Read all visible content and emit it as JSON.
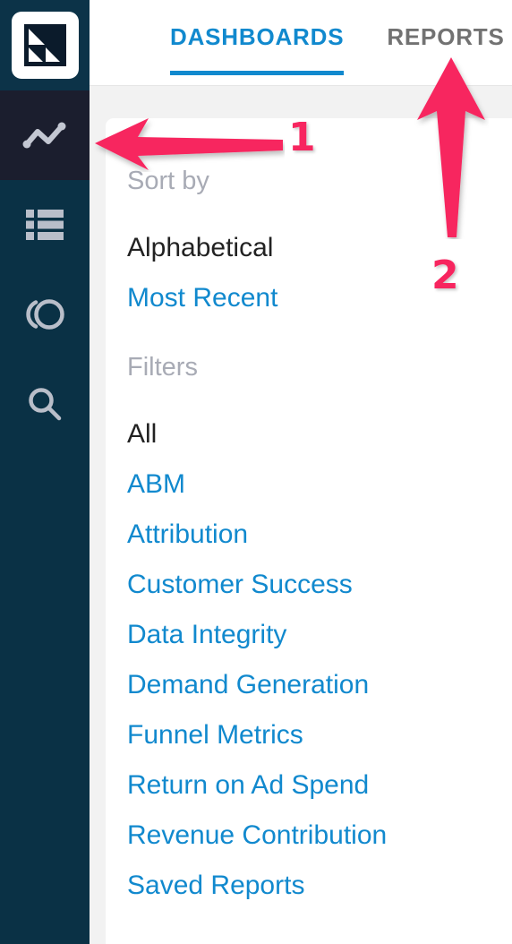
{
  "app": {
    "accent_blue": "#1189ce",
    "sidebar_bg": "#0a3145",
    "annotation_pink": "#f7255f",
    "panel_bg": "#ffffff",
    "page_bg": "#f2f2f2"
  },
  "sidebar": {
    "logo_name": "app-logo",
    "items": [
      {
        "icon": "line-chart-icon",
        "name": "trends",
        "active": true
      },
      {
        "icon": "list-icon",
        "name": "lists",
        "active": false
      },
      {
        "icon": "donut-chart-icon",
        "name": "segments",
        "active": false
      },
      {
        "icon": "search-icon",
        "name": "search",
        "active": false
      }
    ]
  },
  "header": {
    "tabs": [
      {
        "label": "DASHBOARDS",
        "active": true
      },
      {
        "label": "REPORTS",
        "active": false
      }
    ]
  },
  "panel": {
    "sort_by": {
      "heading": "Sort by",
      "options": [
        {
          "label": "Alphabetical",
          "selected": true
        },
        {
          "label": "Most Recent",
          "selected": false
        }
      ]
    },
    "filters": {
      "heading": "Filters",
      "options": [
        {
          "label": "All",
          "selected": true
        },
        {
          "label": "ABM",
          "selected": false
        },
        {
          "label": "Attribution",
          "selected": false
        },
        {
          "label": "Customer Success",
          "selected": false
        },
        {
          "label": "Data Integrity",
          "selected": false
        },
        {
          "label": "Demand Generation",
          "selected": false
        },
        {
          "label": "Funnel Metrics",
          "selected": false
        },
        {
          "label": "Return on Ad Spend",
          "selected": false
        },
        {
          "label": "Revenue Contribution",
          "selected": false
        },
        {
          "label": "Saved Reports",
          "selected": false
        }
      ]
    }
  },
  "annotations": [
    {
      "label": "1",
      "shape": "left-arrow"
    },
    {
      "label": "2",
      "shape": "up-arrow"
    }
  ]
}
